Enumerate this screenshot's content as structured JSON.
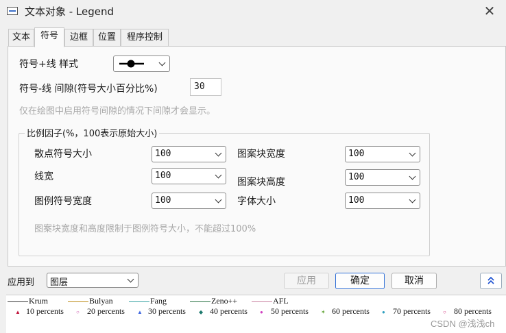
{
  "window": {
    "title": "文本对象 - Legend",
    "close_glyph": "✕"
  },
  "tabs": [
    {
      "label": "文本"
    },
    {
      "label": "符号"
    },
    {
      "label": "边框"
    },
    {
      "label": "位置"
    },
    {
      "label": "程序控制"
    }
  ],
  "symbol_tab": {
    "style_label": "符号+线 样式",
    "gap_label": "符号-线 间隙(符号大小百分比%)",
    "gap_value": "30",
    "gap_hint": "仅在绘图中启用符号间隙的情况下间隙才会显示。",
    "scale_group": {
      "title": "比例因子(%，100表示原始大小)",
      "fields": [
        {
          "label": "散点符号大小",
          "value": "100"
        },
        {
          "label": "线宽",
          "value": "100"
        },
        {
          "label": "图例符号宽度",
          "value": "100"
        },
        {
          "label": "图案块宽度",
          "value": "100"
        },
        {
          "label": "图案块高度",
          "value": "100"
        },
        {
          "label": "字体大小",
          "value": "100"
        }
      ],
      "hint": "图案块宽度和高度限制于图例符号大小，不能超过100%"
    }
  },
  "apply": {
    "label": "应用到",
    "value": "图层"
  },
  "buttons": {
    "apply": "应用",
    "ok": "确定",
    "cancel": "取消"
  },
  "legend_preview": {
    "lines": [
      {
        "name": "Krum",
        "color": "#333333"
      },
      {
        "name": "Bulyan",
        "color": "#b8860b"
      },
      {
        "name": "Fang",
        "color": "#2a9d9d"
      },
      {
        "name": "Zeno++",
        "color": "#1e6b3a"
      },
      {
        "name": "AFL",
        "color": "#c77b9b"
      }
    ],
    "markers": [
      {
        "name": "10 percents",
        "symbol": "▲",
        "color": "#c0143c"
      },
      {
        "name": "20 percents",
        "symbol": "○",
        "color": "#cc55aa"
      },
      {
        "name": "30 percents",
        "symbol": "▲",
        "color": "#4169e1"
      },
      {
        "name": "40 percents",
        "symbol": "◆",
        "color": "#1e7a6e"
      },
      {
        "name": "50 percents",
        "symbol": "●",
        "color": "#d040c0"
      },
      {
        "name": "60 percents",
        "symbol": "✶",
        "color": "#5aa02c"
      },
      {
        "name": "70 percents",
        "symbol": "●",
        "color": "#30a0c0"
      },
      {
        "name": "80 percents",
        "symbol": "○",
        "color": "#d0307a"
      }
    ]
  },
  "watermark": "CSDN @浅浅ch"
}
